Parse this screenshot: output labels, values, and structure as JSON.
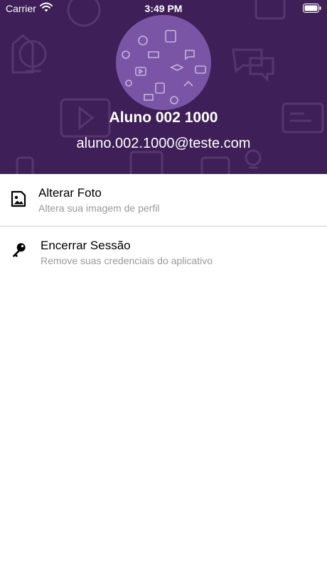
{
  "status_bar": {
    "carrier": "Carrier",
    "time": "3:49 PM",
    "wifi_icon": "wifi-icon",
    "battery_icon": "battery-icon"
  },
  "profile": {
    "name": "Aluno 002 1000",
    "email": "aluno.002.1000@teste.com",
    "avatar_icon": "avatar-placeholder"
  },
  "menu": {
    "change_photo": {
      "icon": "image-icon",
      "title": "Alterar Foto",
      "subtitle": "Altera sua imagem de perfil"
    },
    "logout": {
      "icon": "key-icon",
      "title": "Encerrar Sessão",
      "subtitle": "Remove suas credenciais do aplicativo"
    }
  },
  "colors": {
    "header_background": "#3e1f57",
    "avatar_background": "#7a55a6",
    "subtitle_text": "#9a9a9a",
    "divider": "#d4d4d4"
  }
}
